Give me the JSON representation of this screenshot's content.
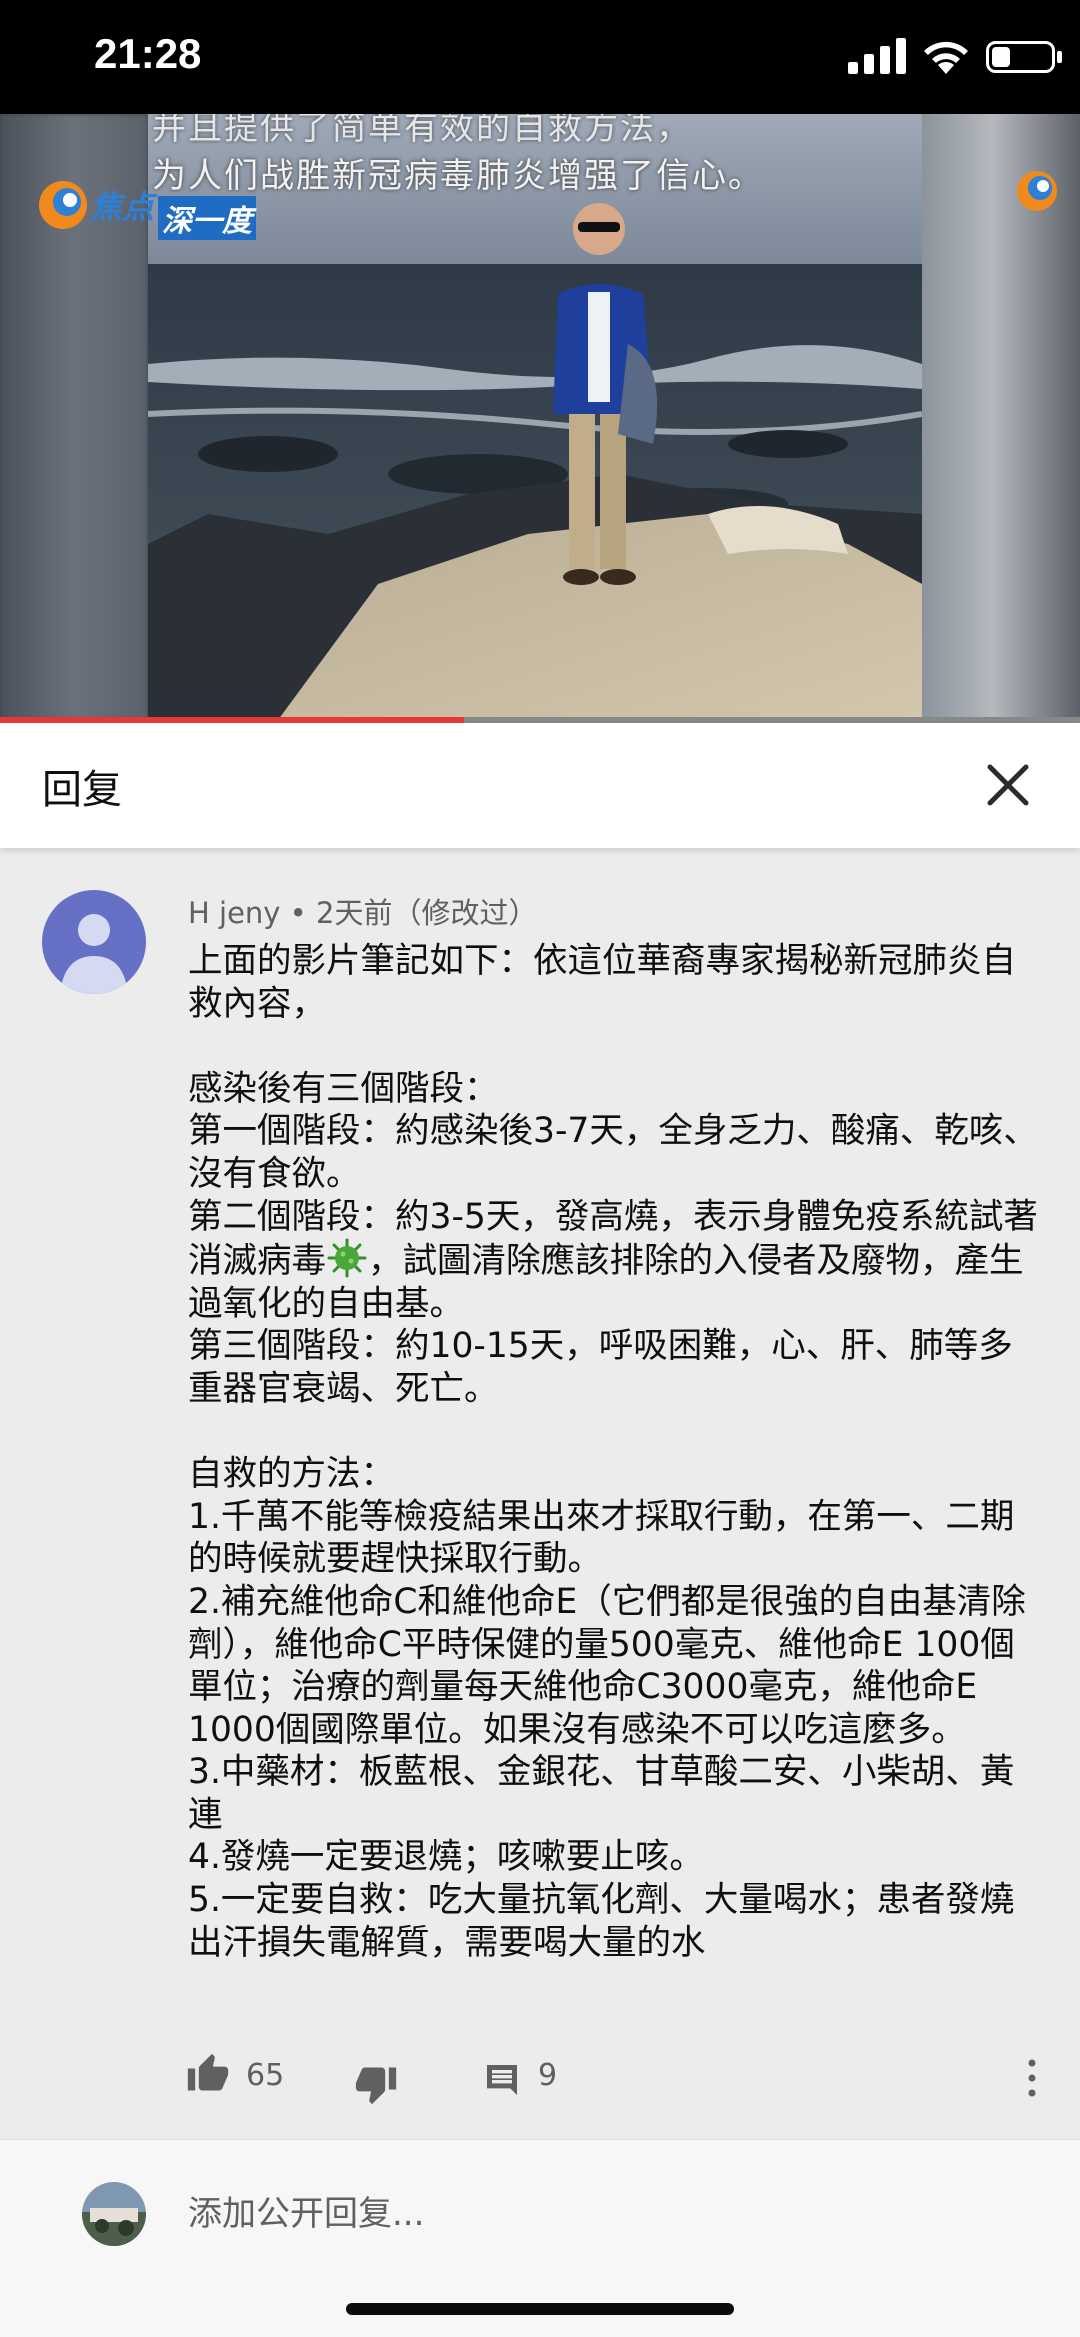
{
  "status_bar": {
    "time": "21:28"
  },
  "video": {
    "caption_line1": "并且提供了简单有效的自救方法，",
    "caption_line2": "为人们战胜新冠病毒肺炎增强了信心。",
    "logo_text_1": "焦点",
    "logo_text_2": "深一度",
    "progress_percent": 43
  },
  "header": {
    "title": "回复"
  },
  "comment": {
    "author": "H jeny",
    "time": "2天前（修改过）",
    "body_intro": "上面的影片筆記如下：依這位華裔專家揭秘新冠肺炎自救內容，\n\n感染後有三個階段：\n第一個階段：約感染後3-7天，全身乏力、酸痛、乾咳、沒有食欲。\n第二個階段：約3-5天，發高燒，表示身體免疫系統試著消滅病毒",
    "body_rest": "，試圖清除應該排除的入侵者及廢物，產生過氧化的自由基。\n第三個階段：約10-15天，呼吸困難，心、肝、肺等多重器官衰竭、死亡。\n\n自救的方法：\n1.千萬不能等檢疫結果出來才採取行動，在第一、二期的時候就要趕快採取行動。\n2.補充維他命C和維他命E（它們都是很強的自由基清除劑），維他命C平時保健的量500毫克、維他命E 100個單位；治療的劑量每天維他命C3000毫克，維他命E 1000個國際單位。如果沒有感染不可以吃這麼多。\n3.中藥材：板藍根、金銀花、甘草酸二安、小柴胡、黃連\n4.發燒一定要退燒；咳嗽要止咳。\n5.一定要自救：吃大量抗氧化劑、大量喝水；患者發燒出汗損失電解質，需要喝大量的水",
    "like_count": "65",
    "reply_count": "9"
  },
  "add_reply": {
    "placeholder": "添加公开回复..."
  },
  "icons": [
    "signal-icon",
    "wifi-icon",
    "battery-icon",
    "close-icon",
    "thumb-up-icon",
    "thumb-down-icon",
    "reply-icon",
    "more-vert-icon",
    "virus-emoji"
  ],
  "colors": {
    "accent": "#e53935",
    "avatar_bg": "#6670c4",
    "muted_text": "#606060"
  }
}
